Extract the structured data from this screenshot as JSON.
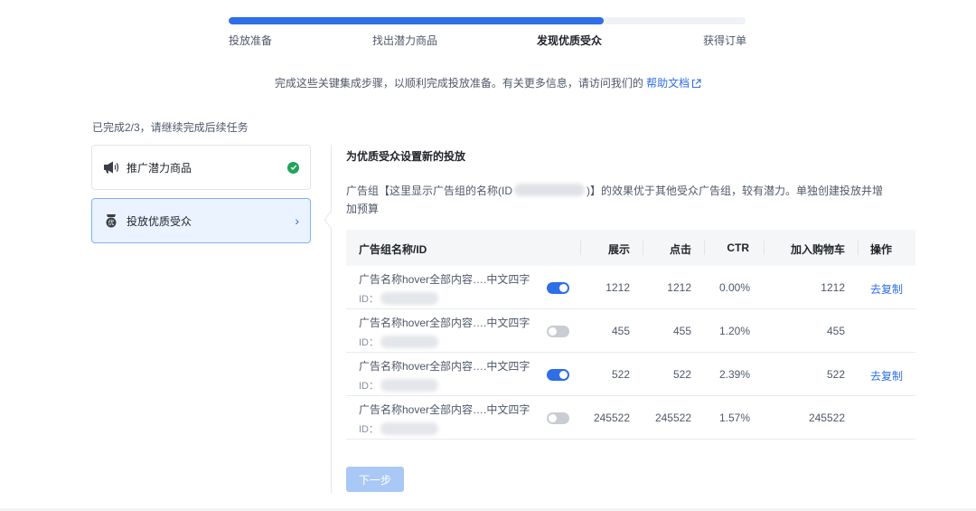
{
  "progress": {
    "fraction": 0.725,
    "steps": [
      "投放准备",
      "找出潜力商品",
      "发现优质受众",
      "获得订单"
    ],
    "active_step": 2
  },
  "intro": {
    "text": "完成这些关键集成步骤，以顺利完成投放准备。有关更多信息，请访问我们的",
    "link": "帮助文档"
  },
  "done_text": "已完成2/3，请继续完成后续任务",
  "tasks": [
    {
      "label": "推广潜力商品",
      "icon": "megaphone-icon",
      "status": "done"
    },
    {
      "label": "投放优质受众",
      "icon": "badge-icon",
      "icon_char": "优",
      "status": "selected"
    }
  ],
  "section": {
    "title": "为优质受众设置新的投放",
    "desc_part1": "广告组【这里显示广告组的名称(ID",
    "desc_part2": ")】的效果优于其他受众广告组，较有潜力。单独创建投放并增",
    "desc_part3": "加预算"
  },
  "table": {
    "headers": {
      "name": "广告组名称/ID",
      "impressions": "展示",
      "clicks": "点击",
      "ctr": "CTR",
      "cart": "加入购物车",
      "action": "操作"
    },
    "rows": [
      {
        "name": "广告名称hover全部内容….中文四字",
        "id_label": "ID：",
        "enabled": true,
        "impressions": "1212",
        "clicks": "1212",
        "ctr": "0.00%",
        "cart": "1212",
        "action": "去复制"
      },
      {
        "name": "广告名称hover全部内容….中文四字",
        "id_label": "ID：",
        "enabled": false,
        "impressions": "455",
        "clicks": "455",
        "ctr": "1.20%",
        "cart": "455",
        "action": ""
      },
      {
        "name": "广告名称hover全部内容….中文四字",
        "id_label": "ID：",
        "enabled": true,
        "impressions": "522",
        "clicks": "522",
        "ctr": "2.39%",
        "cart": "522",
        "action": "去复制"
      },
      {
        "name": "广告名称hover全部内容….中文四字",
        "id_label": "ID：",
        "enabled": false,
        "impressions": "245522",
        "clicks": "245522",
        "ctr": "1.57%",
        "cart": "245522",
        "action": ""
      }
    ]
  },
  "next_button": "下一步",
  "colors": {
    "accent": "#2e6ee6",
    "success": "#21a35a",
    "disabled_button": "#a9c8f6"
  }
}
